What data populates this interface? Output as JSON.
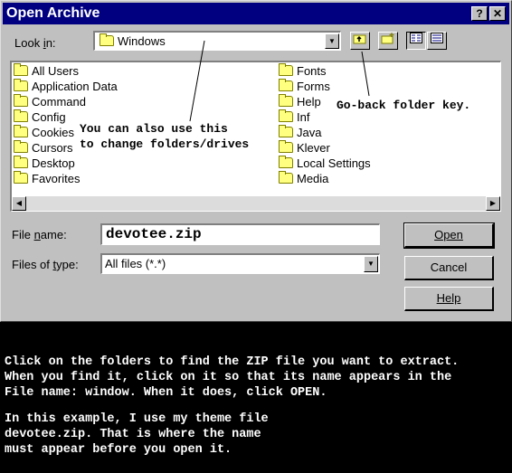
{
  "window": {
    "title": "Open Archive",
    "help_btn": "?",
    "close_btn": "✕"
  },
  "lookin": {
    "label_pre": "Look ",
    "label_ul": "i",
    "label_post": "n:",
    "value": "Windows"
  },
  "toolbar": {
    "up_icon": "up-folder-icon",
    "newfolder_icon": "new-folder-icon",
    "list_icon": "list-view-icon",
    "details_icon": "details-view-icon"
  },
  "files": {
    "col1": [
      "All Users",
      "Application Data",
      "Command",
      "Config",
      "Cookies",
      "Cursors",
      "Desktop",
      "Favorites"
    ],
    "col2": [
      "Fonts",
      "Forms",
      "Help",
      "Inf",
      "Java",
      "Klever",
      "Local Settings",
      "Media"
    ]
  },
  "filename": {
    "label_pre": "File ",
    "label_ul": "n",
    "label_post": "ame:",
    "value": "devotee.zip"
  },
  "filetype": {
    "label_pre": "Files of ",
    "label_ul": "t",
    "label_post": "ype:",
    "value": "All files (*.*)"
  },
  "buttons": {
    "open": "Open",
    "cancel": "Cancel",
    "help": "Help"
  },
  "annotations": {
    "folders_drives": "You can also use this\nto change folders/drives",
    "go_back": "Go-back folder key."
  },
  "instructions": {
    "para1": "Click on the folders to find the ZIP file you want to extract.\nWhen you find it, click on it so that its name appears in the\nFile name: window. When it does, click OPEN.",
    "para2": "In this example, I use my theme file\ndevotee.zip. That is where the name\nmust appear before you open it."
  }
}
